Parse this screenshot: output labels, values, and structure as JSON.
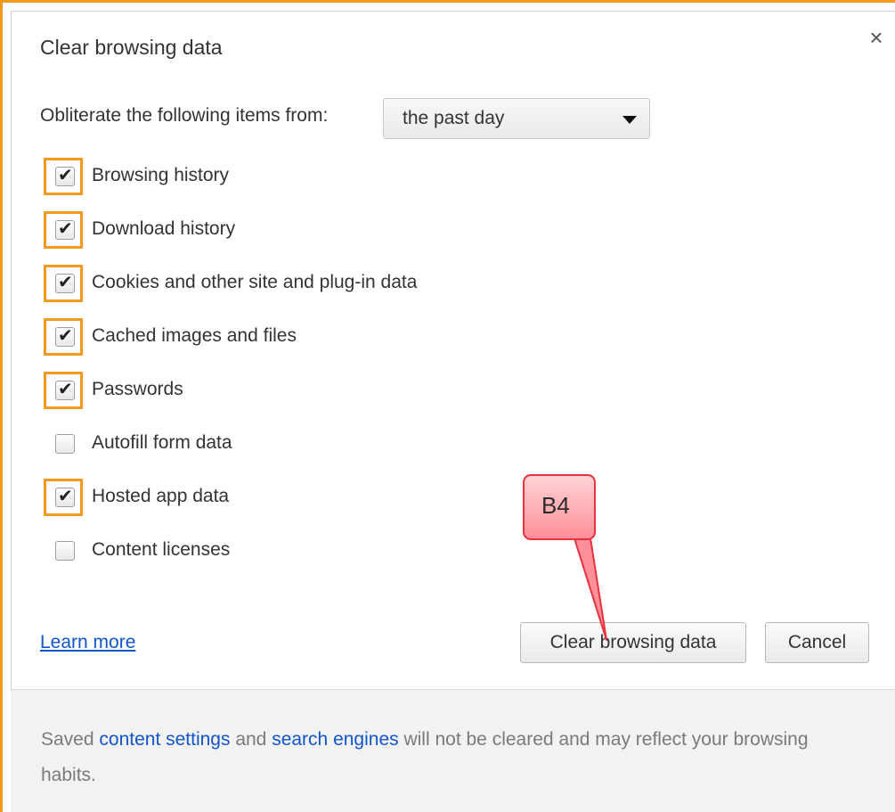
{
  "dialog": {
    "title": "Clear browsing data",
    "close_glyph": "×",
    "obliterate_label": "Obliterate the following items from:",
    "time_range": {
      "selected": "the past day"
    }
  },
  "options": [
    {
      "label": "Browsing history",
      "checked": true,
      "highlighted": true
    },
    {
      "label": "Download history",
      "checked": true,
      "highlighted": true
    },
    {
      "label": "Cookies and other site and plug-in data",
      "checked": true,
      "highlighted": true
    },
    {
      "label": "Cached images and files",
      "checked": true,
      "highlighted": true
    },
    {
      "label": "Passwords",
      "checked": true,
      "highlighted": true
    },
    {
      "label": "Autofill form data",
      "checked": false,
      "highlighted": false
    },
    {
      "label": "Hosted app data",
      "checked": true,
      "highlighted": true
    },
    {
      "label": "Content licenses",
      "checked": false,
      "highlighted": false
    }
  ],
  "actions": {
    "learn_more": "Learn more",
    "clear_button": "Clear browsing data",
    "cancel_button": "Cancel"
  },
  "footer": {
    "prefix": "Saved ",
    "link1": "content settings",
    "middle": " and ",
    "link2": "search engines",
    "suffix": " will not be cleared and may reflect your browsing habits."
  },
  "annotation": {
    "callout_label": "B4"
  },
  "colors": {
    "highlight_border": "#f29a1e",
    "link": "#1155cc",
    "callout_fill": "#ff8f98",
    "callout_border": "#e8323f"
  },
  "icons": {
    "close": "close-icon",
    "dropdown": "dropdown-arrow-icon",
    "checkmark": "checkmark-icon"
  }
}
